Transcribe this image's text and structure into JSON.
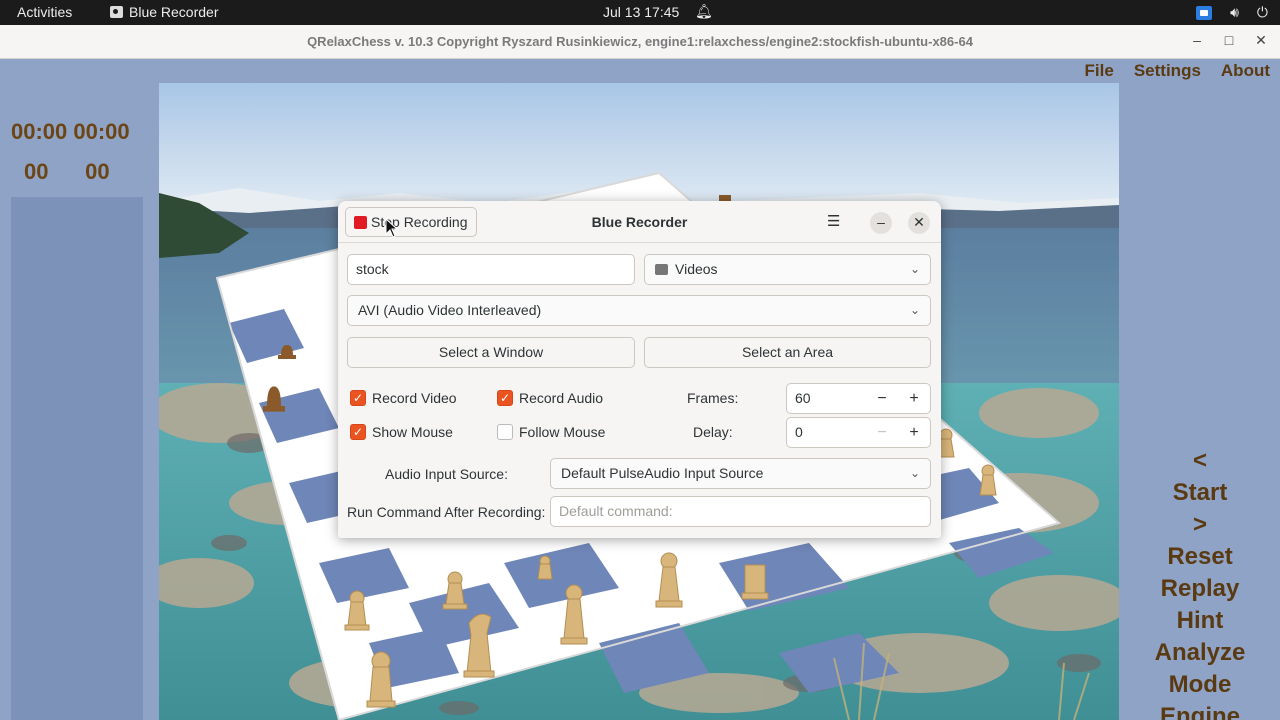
{
  "topbar": {
    "activities": "Activities",
    "app_name": "Blue Recorder",
    "clock": "Jul 13  17:45"
  },
  "main_window": {
    "title": "QRelaxChess v. 10.3 Copyright Ryszard Rusinkiewicz, engine1:relaxchess/engine2:stockfish-ubuntu-x86-64",
    "menu": [
      "File",
      "Settings",
      "About"
    ],
    "clock_top": "00:00 00:00",
    "clock_bottom": "00      00",
    "side_menu": [
      "<",
      "Start",
      ">",
      "Reset",
      "Replay",
      "Hint",
      "Analyze",
      "Mode",
      "Engine"
    ]
  },
  "recorder": {
    "title": "Blue Recorder",
    "stop_label": "Stop Recording",
    "filename": "stock",
    "folder": "Videos",
    "format": "AVI (Audio Video Interleaved)",
    "select_window": "Select a Window",
    "select_area": "Select an Area",
    "record_video": "Record Video",
    "record_audio": "Record Audio",
    "show_mouse": "Show Mouse",
    "follow_mouse": "Follow Mouse",
    "frames_label": "Frames:",
    "frames_value": "60",
    "delay_label": "Delay:",
    "delay_value": "0",
    "audio_source_label": "Audio Input Source:",
    "audio_source": "Default PulseAudio Input Source",
    "run_command_label": "Run Command After Recording:",
    "run_command_placeholder": "Default command:",
    "checks": {
      "record_video": true,
      "record_audio": true,
      "show_mouse": true,
      "follow_mouse": false
    }
  },
  "colors": {
    "accent": "#e95420",
    "board_dark": "#6f86b8",
    "board_light": "#ffffff",
    "chess_text": "#5a3a12"
  }
}
